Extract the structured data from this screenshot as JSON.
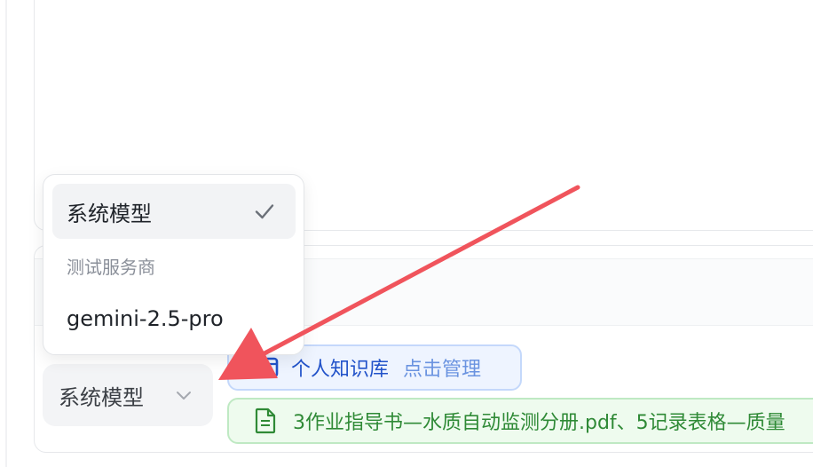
{
  "dropdown": {
    "selected_option": "系统模型",
    "group_label": "测试服务商",
    "option": "gemini-2.5-pro",
    "check_icon": "checkmark-icon"
  },
  "model_select": {
    "value": "系统模型",
    "chevron_icon": "chevron-down-icon"
  },
  "knowledge_base": {
    "name": "个人知识库",
    "manage_link": "点击管理",
    "icon": "folder-icon"
  },
  "attached_files": {
    "text": "3作业指导书—水质自动监测分册.pdf、5记录表格—质量",
    "icon": "document-icon"
  },
  "colors": {
    "annotation_arrow": "#f0545c",
    "kb_accent": "#2152c9",
    "file_accent": "#2f8a36"
  }
}
